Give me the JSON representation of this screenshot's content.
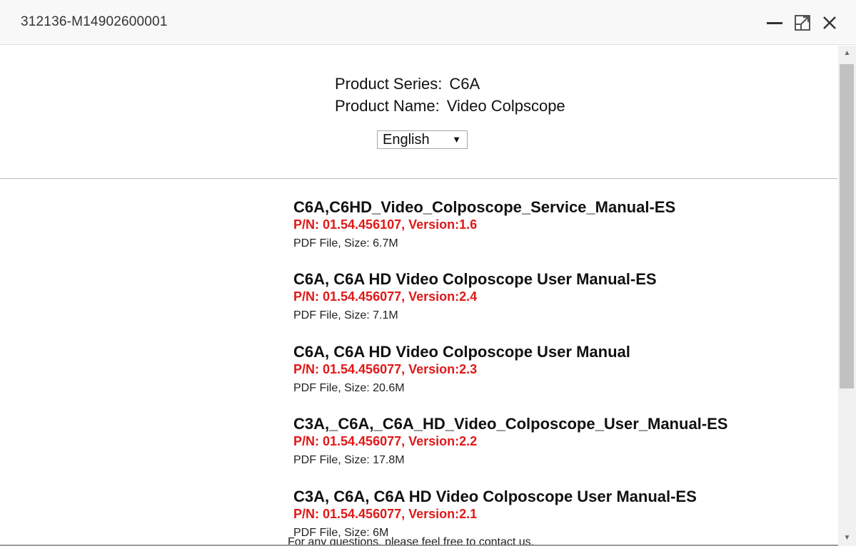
{
  "window": {
    "title": "312136-M14902600001"
  },
  "product": {
    "series_label": "Product Series:",
    "series_value": "C6A",
    "name_label": "Product Name:",
    "name_value": "Video Colpscope"
  },
  "language": {
    "selected": "English"
  },
  "documents": [
    {
      "name": "C6A,C6HD_Video_Colposcope_Service_Manual-ES",
      "pn": "P/N: 01.54.456107, Version:1.6",
      "meta": "PDF File, Size: 6.7M"
    },
    {
      "name": "C6A, C6A HD Video Colposcope User Manual-ES",
      "pn": "P/N: 01.54.456077, Version:2.4",
      "meta": "PDF File, Size: 7.1M"
    },
    {
      "name": "C6A, C6A HD Video Colposcope User Manual",
      "pn": "P/N: 01.54.456077, Version:2.3",
      "meta": "PDF File, Size: 20.6M"
    },
    {
      "name": "C3A,_C6A,_C6A_HD_Video_Colposcope_User_Manual-ES",
      "pn": "P/N: 01.54.456077, Version:2.2",
      "meta": "PDF File, Size: 17.8M"
    },
    {
      "name": "C3A, C6A, C6A HD Video Colposcope User Manual-ES",
      "pn": "P/N: 01.54.456077, Version:2.1",
      "meta": "PDF File, Size: 6M"
    }
  ],
  "footer": {
    "text": "For any questions, please feel free to contact us."
  },
  "colors": {
    "part_number": "#e01818",
    "titlebar_bg": "#f8f8f8"
  }
}
